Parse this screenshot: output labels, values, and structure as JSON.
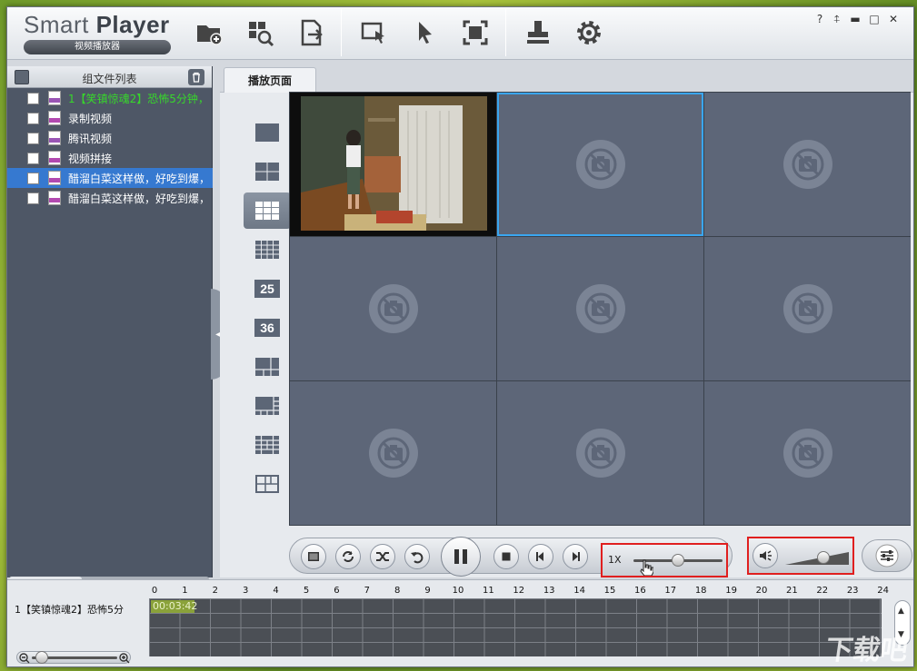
{
  "app": {
    "brand_name_light": "Smart ",
    "brand_name_bold": "Player",
    "brand_subtitle": "视频播放器"
  },
  "toolbar": {
    "icons": [
      "add-folder-icon",
      "search-files-icon",
      "export-file-icon",
      "select-window-icon",
      "pointer-icon",
      "fullscreen-icon",
      "stamp-icon",
      "gear-icon"
    ]
  },
  "window_controls": {
    "help": "?",
    "pin": "⍏",
    "minimize": "▬",
    "maximize": "□",
    "close": "✕"
  },
  "file_panel": {
    "title": "组文件列表",
    "files": [
      {
        "label": "1【笑镇惊魂2】恐怖5分钟，",
        "type": "FLV",
        "state": "playing"
      },
      {
        "label": "录制视频",
        "type": "MP4",
        "state": "normal"
      },
      {
        "label": "腾讯视频",
        "type": "FLV",
        "state": "normal"
      },
      {
        "label": "视频拼接",
        "type": "MP4",
        "state": "normal"
      },
      {
        "label": "醋溜白菜这样做，好吃到爆，",
        "type": "MP4",
        "state": "selected"
      },
      {
        "label": "醋溜白菜这样做，好吃到爆，",
        "type": "MP4",
        "state": "normal"
      }
    ]
  },
  "tabs": [
    {
      "label": "播放页面"
    }
  ],
  "layouts": [
    {
      "id": "1x1",
      "label": ""
    },
    {
      "id": "2x2",
      "label": ""
    },
    {
      "id": "3x3",
      "label": "",
      "active": true
    },
    {
      "id": "4x4",
      "label": ""
    },
    {
      "id": "5x5",
      "label": "25"
    },
    {
      "id": "6x6",
      "label": "36"
    },
    {
      "id": "1+5",
      "label": ""
    },
    {
      "id": "1+7",
      "label": ""
    },
    {
      "id": "custom-a",
      "label": ""
    },
    {
      "id": "custom-b",
      "label": ""
    }
  ],
  "controls": {
    "speed_label": "1X",
    "speed_value": 0.5,
    "volume_value": 0.6
  },
  "timeline": {
    "track_name": "1【笑镇惊魂2】恐怖5分",
    "ticks": [
      "0",
      "1",
      "2",
      "3",
      "4",
      "5",
      "6",
      "7",
      "8",
      "9",
      "10",
      "11",
      "12",
      "13",
      "14",
      "15",
      "16",
      "17",
      "18",
      "19",
      "20",
      "21",
      "22",
      "23",
      "24"
    ],
    "segment_time": "00:03:42"
  },
  "watermark": "下载吧"
}
